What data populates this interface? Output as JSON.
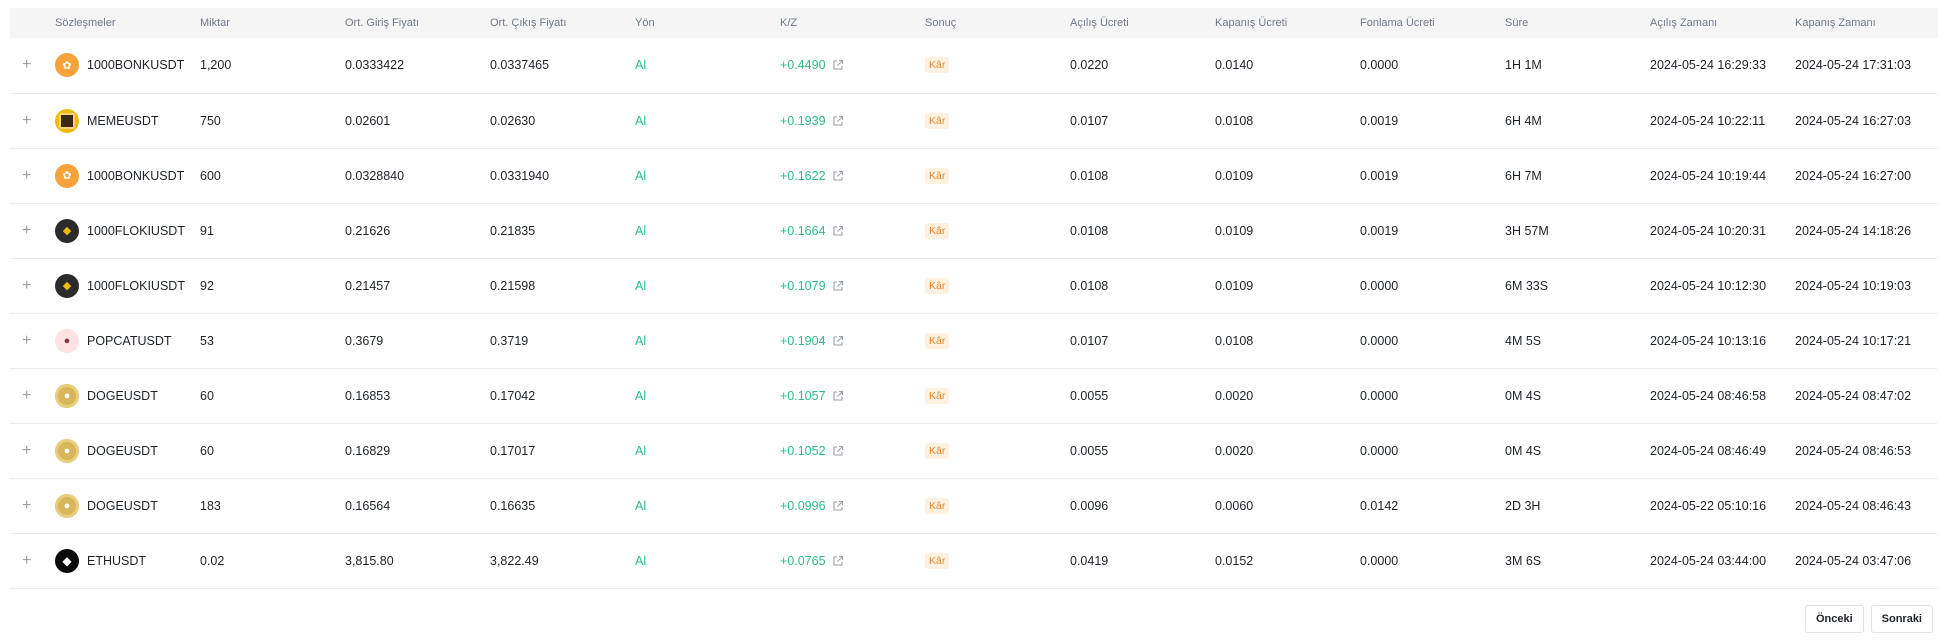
{
  "table": {
    "headers": [
      "",
      "Sözleşmeler",
      "Miktar",
      "Ort. Giriş Fiyatı",
      "Ort. Çıkış Fiyatı",
      "Yön",
      "K/Z",
      "Sonuç",
      "Açılış Ücreti",
      "Kapanış Ücreti",
      "Fonlama Ücreti",
      "Süre",
      "Açılış Zamanı",
      "Kapanış Zamanı"
    ],
    "rows": [
      {
        "symbol": "1000BONKUSDT",
        "icon": "bonk-coin-icon",
        "qty": "1,200",
        "entry": "0.0333422",
        "exit": "0.0337465",
        "side": "Al",
        "pnl": "+0.4490",
        "result": "Kâr",
        "open_fee": "0.0220",
        "close_fee": "0.0140",
        "funding": "0.0000",
        "duration": "1H 1M",
        "open_time": "2024-05-24 16:29:33",
        "close_time": "2024-05-24 17:31:03"
      },
      {
        "symbol": "MEMEUSDT",
        "icon": "meme-coin-icon",
        "qty": "750",
        "entry": "0.02601",
        "exit": "0.02630",
        "side": "Al",
        "pnl": "+0.1939",
        "result": "Kâr",
        "open_fee": "0.0107",
        "close_fee": "0.0108",
        "funding": "0.0019",
        "duration": "6H 4M",
        "open_time": "2024-05-24 10:22:11",
        "close_time": "2024-05-24 16:27:03"
      },
      {
        "symbol": "1000BONKUSDT",
        "icon": "bonk-coin-icon",
        "qty": "600",
        "entry": "0.0328840",
        "exit": "0.0331940",
        "side": "Al",
        "pnl": "+0.1622",
        "result": "Kâr",
        "open_fee": "0.0108",
        "close_fee": "0.0109",
        "funding": "0.0019",
        "duration": "6H 7M",
        "open_time": "2024-05-24 10:19:44",
        "close_time": "2024-05-24 16:27:00"
      },
      {
        "symbol": "1000FLOKIUSDT",
        "icon": "floki-coin-icon",
        "qty": "91",
        "entry": "0.21626",
        "exit": "0.21835",
        "side": "Al",
        "pnl": "+0.1664",
        "result": "Kâr",
        "open_fee": "0.0108",
        "close_fee": "0.0109",
        "funding": "0.0019",
        "duration": "3H 57M",
        "open_time": "2024-05-24 10:20:31",
        "close_time": "2024-05-24 14:18:26"
      },
      {
        "symbol": "1000FLOKIUSDT",
        "icon": "floki-coin-icon",
        "qty": "92",
        "entry": "0.21457",
        "exit": "0.21598",
        "side": "Al",
        "pnl": "+0.1079",
        "result": "Kâr",
        "open_fee": "0.0108",
        "close_fee": "0.0109",
        "funding": "0.0000",
        "duration": "6M 33S",
        "open_time": "2024-05-24 10:12:30",
        "close_time": "2024-05-24 10:19:03"
      },
      {
        "symbol": "POPCATUSDT",
        "icon": "popcat-coin-icon",
        "qty": "53",
        "entry": "0.3679",
        "exit": "0.3719",
        "side": "Al",
        "pnl": "+0.1904",
        "result": "Kâr",
        "open_fee": "0.0107",
        "close_fee": "0.0108",
        "funding": "0.0000",
        "duration": "4M 5S",
        "open_time": "2024-05-24 10:13:16",
        "close_time": "2024-05-24 10:17:21"
      },
      {
        "symbol": "DOGEUSDT",
        "icon": "doge-coin-icon",
        "qty": "60",
        "entry": "0.16853",
        "exit": "0.17042",
        "side": "Al",
        "pnl": "+0.1057",
        "result": "Kâr",
        "open_fee": "0.0055",
        "close_fee": "0.0020",
        "funding": "0.0000",
        "duration": "0M 4S",
        "open_time": "2024-05-24 08:46:58",
        "close_time": "2024-05-24 08:47:02"
      },
      {
        "symbol": "DOGEUSDT",
        "icon": "doge-coin-icon",
        "qty": "60",
        "entry": "0.16829",
        "exit": "0.17017",
        "side": "Al",
        "pnl": "+0.1052",
        "result": "Kâr",
        "open_fee": "0.0055",
        "close_fee": "0.0020",
        "funding": "0.0000",
        "duration": "0M 4S",
        "open_time": "2024-05-24 08:46:49",
        "close_time": "2024-05-24 08:46:53"
      },
      {
        "symbol": "DOGEUSDT",
        "icon": "doge-coin-icon",
        "qty": "183",
        "entry": "0.16564",
        "exit": "0.16635",
        "side": "Al",
        "pnl": "+0.0996",
        "result": "Kâr",
        "open_fee": "0.0096",
        "close_fee": "0.0060",
        "funding": "0.0142",
        "duration": "2D 3H",
        "open_time": "2024-05-22 05:10:16",
        "close_time": "2024-05-24 08:46:43"
      },
      {
        "symbol": "ETHUSDT",
        "icon": "eth-coin-icon",
        "qty": "0.02",
        "entry": "3,815.80",
        "exit": "3,822.49",
        "side": "Al",
        "pnl": "+0.0765",
        "result": "Kâr",
        "open_fee": "0.0419",
        "close_fee": "0.0152",
        "funding": "0.0000",
        "duration": "3M 6S",
        "open_time": "2024-05-24 03:44:00",
        "close_time": "2024-05-24 03:47:06"
      }
    ]
  },
  "pagination": {
    "prev_label": "Önceki",
    "next_label": "Sonraki"
  },
  "colors": {
    "profit": "#2ebd85",
    "badge_text": "#e8862a",
    "badge_bg": "#fdf1e0",
    "header_bg": "#f5f5f5"
  },
  "icons": {
    "expand": "plus-icon",
    "share": "external-link-icon"
  }
}
